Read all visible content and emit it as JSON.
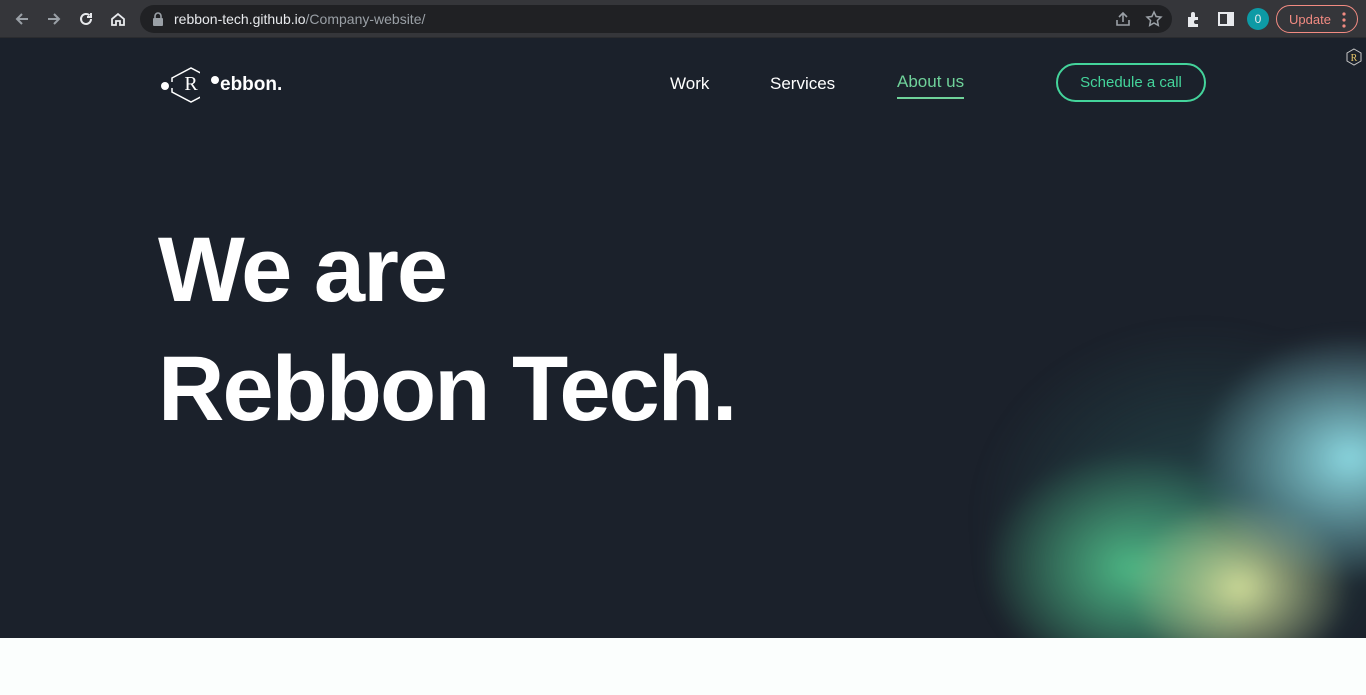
{
  "browser": {
    "url_host": "rebbon-tech.github.io",
    "url_path": "/Company-website/",
    "profile_initial": "0",
    "update_label": "Update"
  },
  "site": {
    "logo_letter": "R",
    "logo_text": "ebbon.",
    "nav": [
      {
        "label": "Work"
      },
      {
        "label": "Services"
      },
      {
        "label": "About us"
      }
    ],
    "cta_label": "Schedule a call",
    "headline_line1": "We are",
    "headline_line2": "Rebbon Tech.",
    "badge_letter": "R"
  },
  "colors": {
    "hero_bg": "#1b212b",
    "accent": "#44d49b",
    "active_nav": "#6fd29a",
    "chrome_bg": "#35363a"
  }
}
